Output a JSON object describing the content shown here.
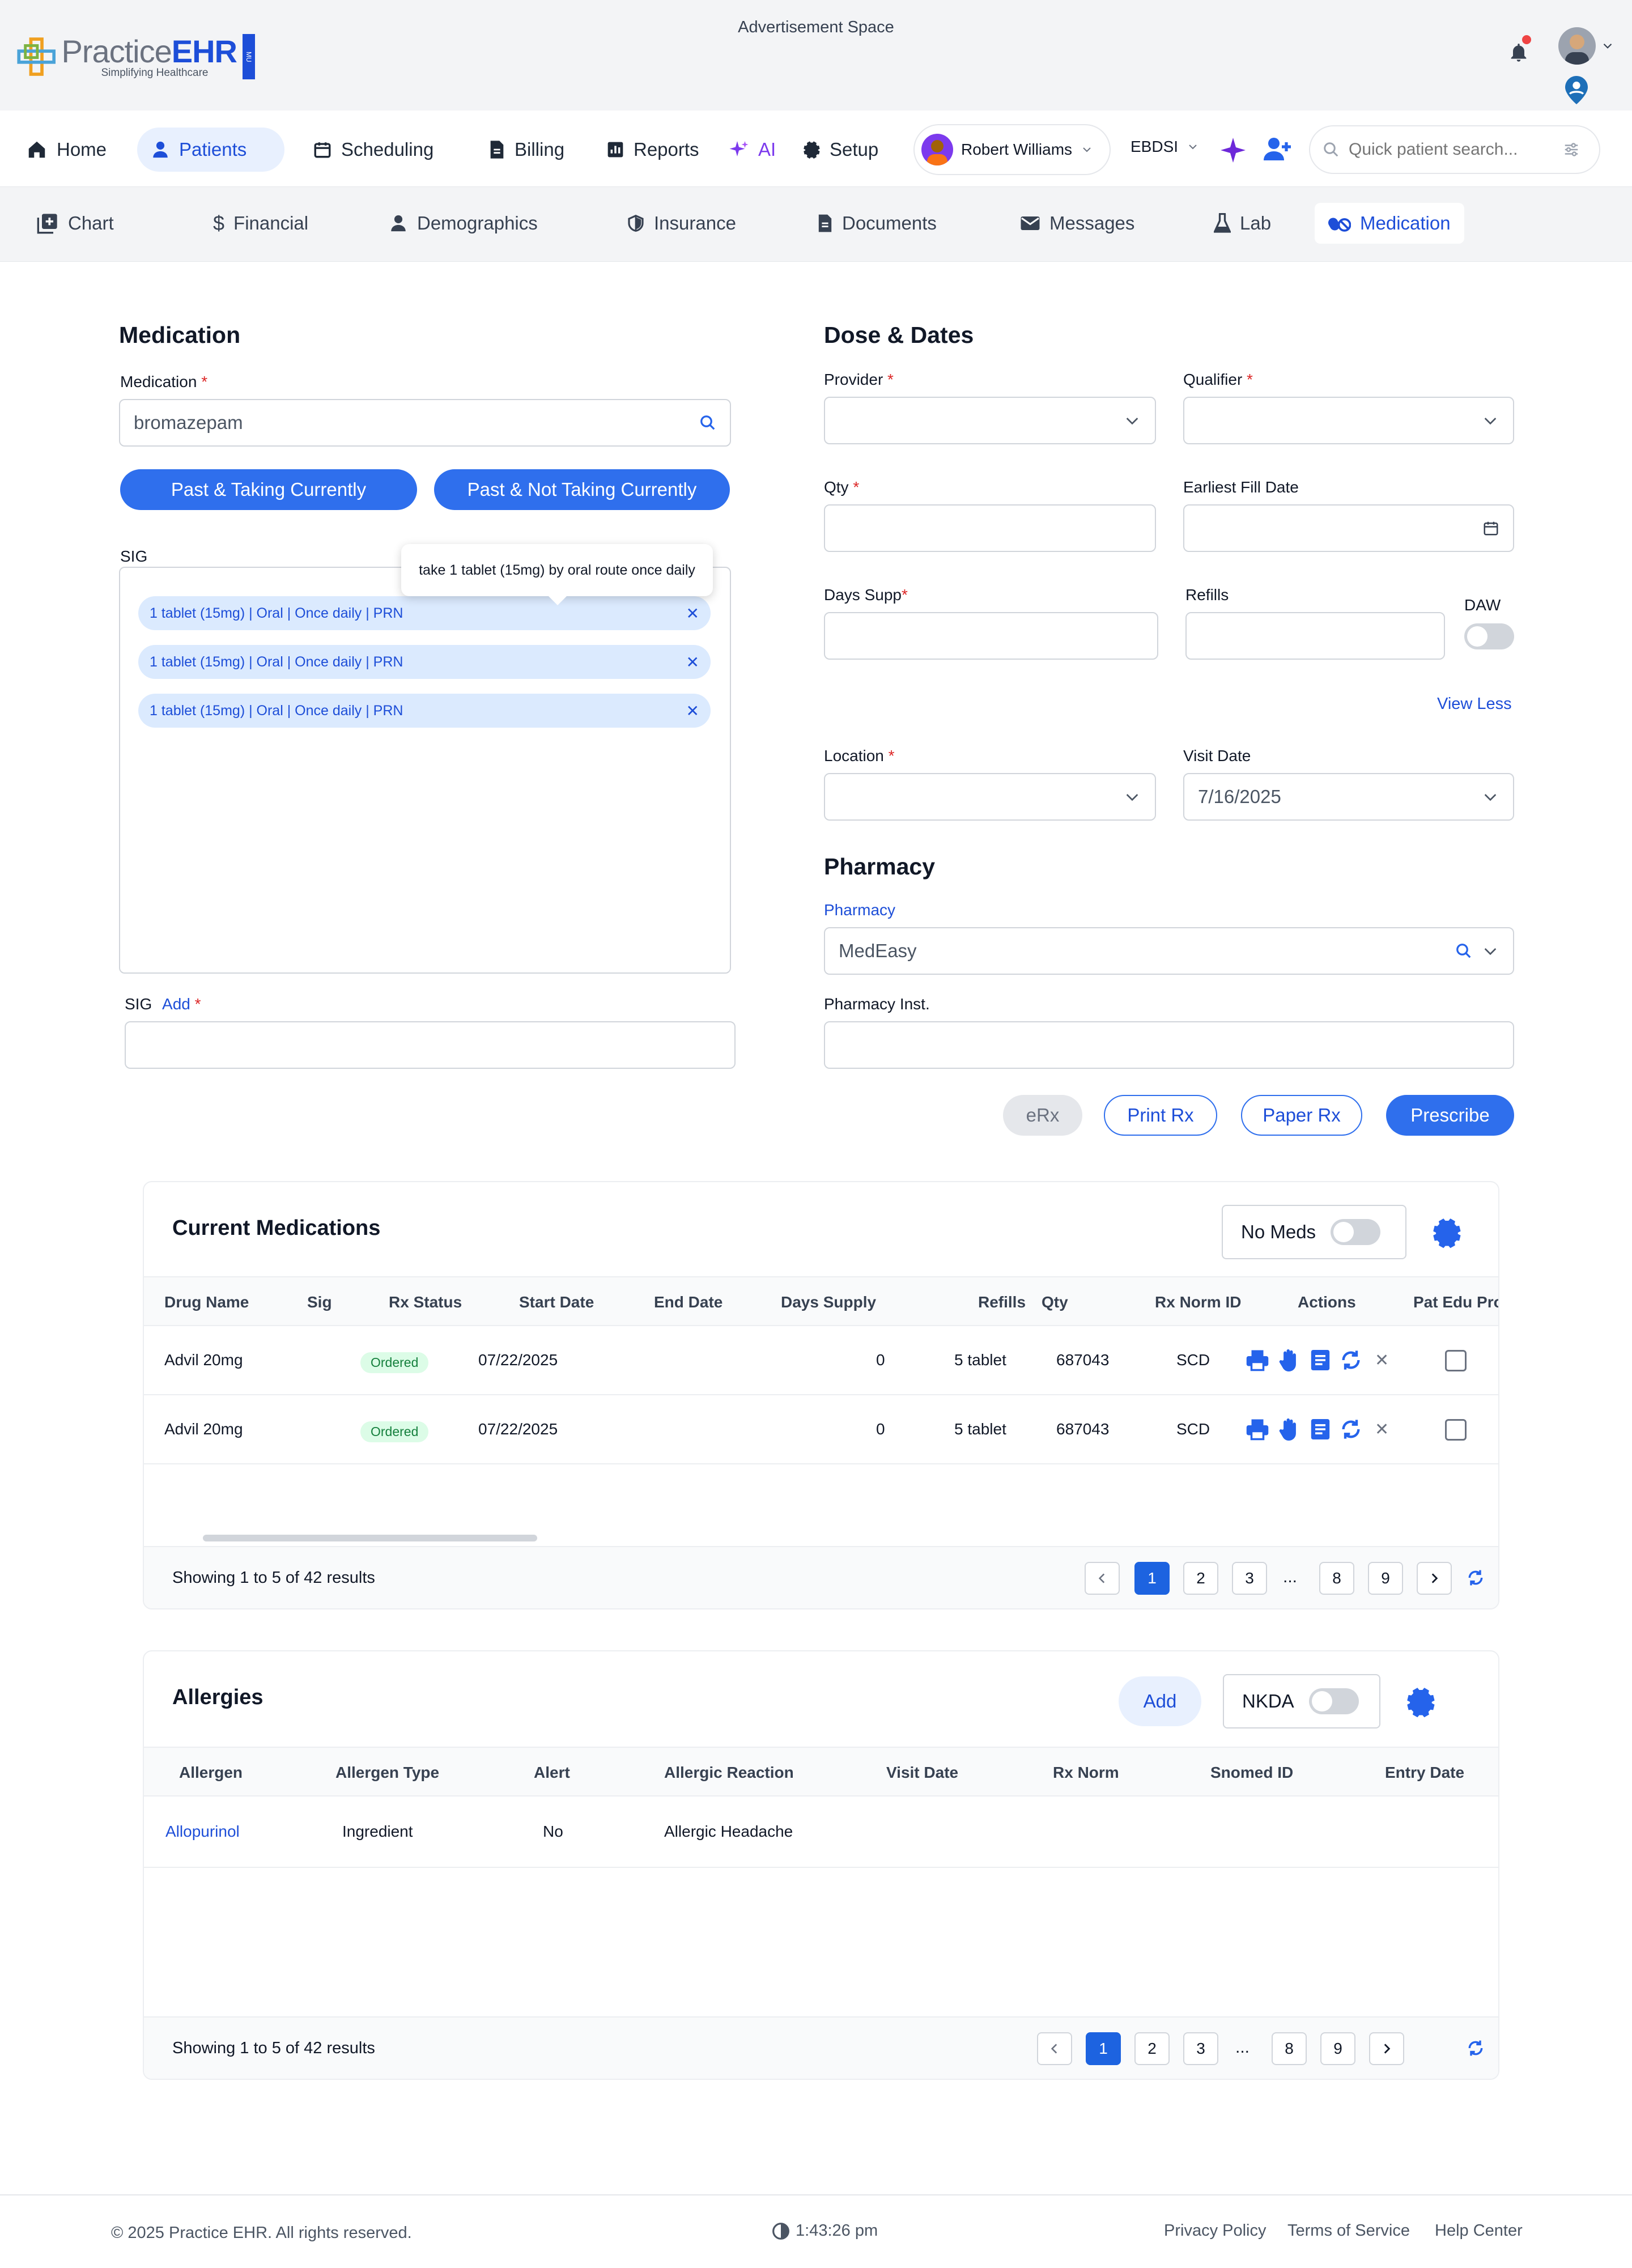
{
  "ad_space": "Advertisement Space",
  "logo": {
    "name": "PracticeEHR",
    "practice": "Practice",
    "ehr": "EHR",
    "tagline": "Simplifying Healthcare",
    "badge": "MU"
  },
  "nav": {
    "items": [
      {
        "label": "Home",
        "icon": "home-icon"
      },
      {
        "label": "Patients",
        "icon": "patients-icon"
      },
      {
        "label": "Scheduling",
        "icon": "calendar-icon"
      },
      {
        "label": "Billing",
        "icon": "document-icon"
      },
      {
        "label": "Reports",
        "icon": "chart-icon"
      },
      {
        "label": "AI",
        "icon": "sparkle-icon"
      },
      {
        "label": "Setup",
        "icon": "gear-icon"
      }
    ],
    "user": "Robert Williams",
    "org": "EBDSI",
    "search_placeholder": "Quick patient search..."
  },
  "subnav": [
    {
      "label": "Chart"
    },
    {
      "label": "Financial"
    },
    {
      "label": "Demographics"
    },
    {
      "label": "Insurance"
    },
    {
      "label": "Documents"
    },
    {
      "label": "Messages"
    },
    {
      "label": "Lab"
    },
    {
      "label": "Medication"
    }
  ],
  "medication": {
    "section_title": "Medication",
    "medication_label": "Medication",
    "medication_value": "bromazepam",
    "btn_past_taking": "Past & Taking Currently",
    "btn_past_not_taking": "Past & Not Taking Currently",
    "sig_label": "SIG",
    "tooltip": "take 1 tablet (15mg) by oral route once daily",
    "sig_chips": [
      "1 tablet (15mg) | Oral | Once daily | PRN",
      "1 tablet (15mg) | Oral | Once daily | PRN",
      "1 tablet (15mg) | Oral | Once daily | PRN"
    ],
    "sig_add_label": "SIG",
    "sig_add_link": "Add"
  },
  "dose": {
    "section_title": "Dose & Dates",
    "provider_label": "Provider",
    "qualifier_label": "Qualifier",
    "qty_label": "Qty",
    "earliest_fill_label": "Earliest Fill Date",
    "days_supp_label": "Days Supp",
    "refills_label": "Refills",
    "daw_label": "DAW",
    "view_less": "View Less",
    "location_label": "Location",
    "visit_date_label": "Visit Date",
    "visit_date_value": "7/16/2025"
  },
  "pharmacy": {
    "section_title": "Pharmacy",
    "pharmacy_label": "Pharmacy",
    "pharmacy_value": "MedEasy",
    "inst_label": "Pharmacy Inst."
  },
  "actions": {
    "erx": "eRx",
    "print_rx": "Print Rx",
    "paper_rx": "Paper Rx",
    "prescribe": "Prescribe"
  },
  "current_meds": {
    "title": "Current Medications",
    "no_meds_label": "No Meds",
    "columns": [
      "Drug Name",
      "Sig",
      "Rx Status",
      "Start Date",
      "End Date",
      "Days Supply",
      "Refills",
      "Qty",
      "Rx Norm ID",
      "Actions",
      "Pat Edu Pro"
    ],
    "rows": [
      {
        "drug": "Advil 20mg",
        "sig": "",
        "status": "Ordered",
        "start": "07/22/2025",
        "end": "",
        "days_supply": "0",
        "refills": "5 tablet",
        "qty": "687043",
        "rxnorm": "SCD"
      },
      {
        "drug": "Advil 20mg",
        "sig": "",
        "status": "Ordered",
        "start": "07/22/2025",
        "end": "",
        "days_supply": "0",
        "refills": "5 tablet",
        "qty": "687043",
        "rxnorm": "SCD"
      }
    ],
    "showing": "Showing 1 to 5 of 42 results",
    "pages": [
      "1",
      "2",
      "3",
      "...",
      "8",
      "9"
    ]
  },
  "allergies": {
    "title": "Allergies",
    "add_label": "Add",
    "nkda_label": "NKDA",
    "columns": [
      "Allergen",
      "Allergen Type",
      "Alert",
      "Allergic Reaction",
      "Visit Date",
      "Rx Norm",
      "Snomed ID",
      "Entry Date"
    ],
    "rows": [
      {
        "allergen": "Allopurinol",
        "type": "Ingredient",
        "alert": "No",
        "reaction": "Allergic Headache",
        "visit_date": "",
        "rxnorm": "",
        "snomed": "",
        "entry_date": ""
      }
    ],
    "showing": "Showing 1 to 5 of 42 results",
    "pages": [
      "1",
      "2",
      "3",
      "...",
      "8",
      "9"
    ]
  },
  "footer": {
    "copyright": "© 2025 Practice EHR. All rights reserved.",
    "time": "1:43:26 pm",
    "links": [
      "Privacy Policy",
      "Terms of Service",
      "Help Center"
    ]
  },
  "colors": {
    "primary": "#2f6fed",
    "active_nav": "#1d4ed8",
    "chip_bg": "#dbeafe",
    "badge_green": "#15803d",
    "required": "#dc2626"
  }
}
